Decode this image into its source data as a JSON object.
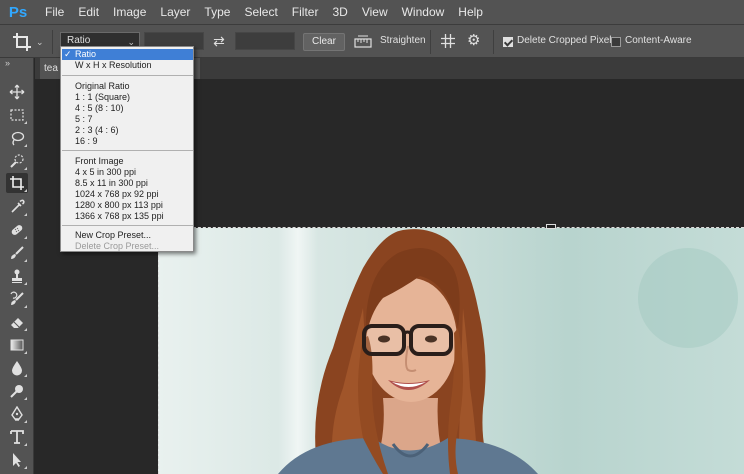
{
  "app": {
    "logo": "Ps",
    "menu": [
      "File",
      "Edit",
      "Image",
      "Layer",
      "Type",
      "Select",
      "Filter",
      "3D",
      "View",
      "Window",
      "Help"
    ]
  },
  "options": {
    "preset_value": "Ratio",
    "width_value": "",
    "height_value": "",
    "clear_label": "Clear",
    "straighten_label": "Straighten",
    "delete_cropped_label": "Delete Cropped Pixels",
    "delete_cropped_checked": true,
    "content_aware_label": "Content-Aware",
    "content_aware_checked": false
  },
  "document": {
    "tab_title": "tea"
  },
  "toolbar": {
    "collapse": "»",
    "tools": [
      "move-icon",
      "marquee-icon",
      "lasso-icon",
      "quick-select-icon",
      "crop-icon",
      "eyedropper-icon",
      "healing-brush-icon",
      "brush-icon",
      "clone-stamp-icon",
      "history-brush-icon",
      "eraser-icon",
      "gradient-icon",
      "blur-icon",
      "dodge-icon",
      "pen-icon",
      "type-icon",
      "path-select-icon"
    ],
    "active_tool": "crop-icon"
  },
  "dropdown": {
    "items": [
      {
        "label": "Ratio",
        "selected": true
      },
      {
        "label": "W x H x Resolution"
      },
      {
        "label": "Original Ratio"
      },
      {
        "label": "1 : 1 (Square)"
      },
      {
        "label": "4 : 5 (8 : 10)"
      },
      {
        "label": "5 : 7"
      },
      {
        "label": "2 : 3 (4 : 6)"
      },
      {
        "label": "16 : 9"
      },
      {
        "label": "Front Image"
      },
      {
        "label": "4 x 5 in 300 ppi"
      },
      {
        "label": "8.5 x 11 in 300 ppi"
      },
      {
        "label": "1024 x 768 px 92 ppi"
      },
      {
        "label": "1280 x 800 px 113 ppi"
      },
      {
        "label": "1366 x 768 px 135 ppi"
      },
      {
        "label": "New Crop Preset..."
      },
      {
        "label": "Delete Crop Preset...",
        "disabled": true
      }
    ]
  },
  "colors": {
    "accent": "#3f7fd6",
    "logo": "#31a8ff",
    "panel": "#535353",
    "canvas": "#282828"
  }
}
